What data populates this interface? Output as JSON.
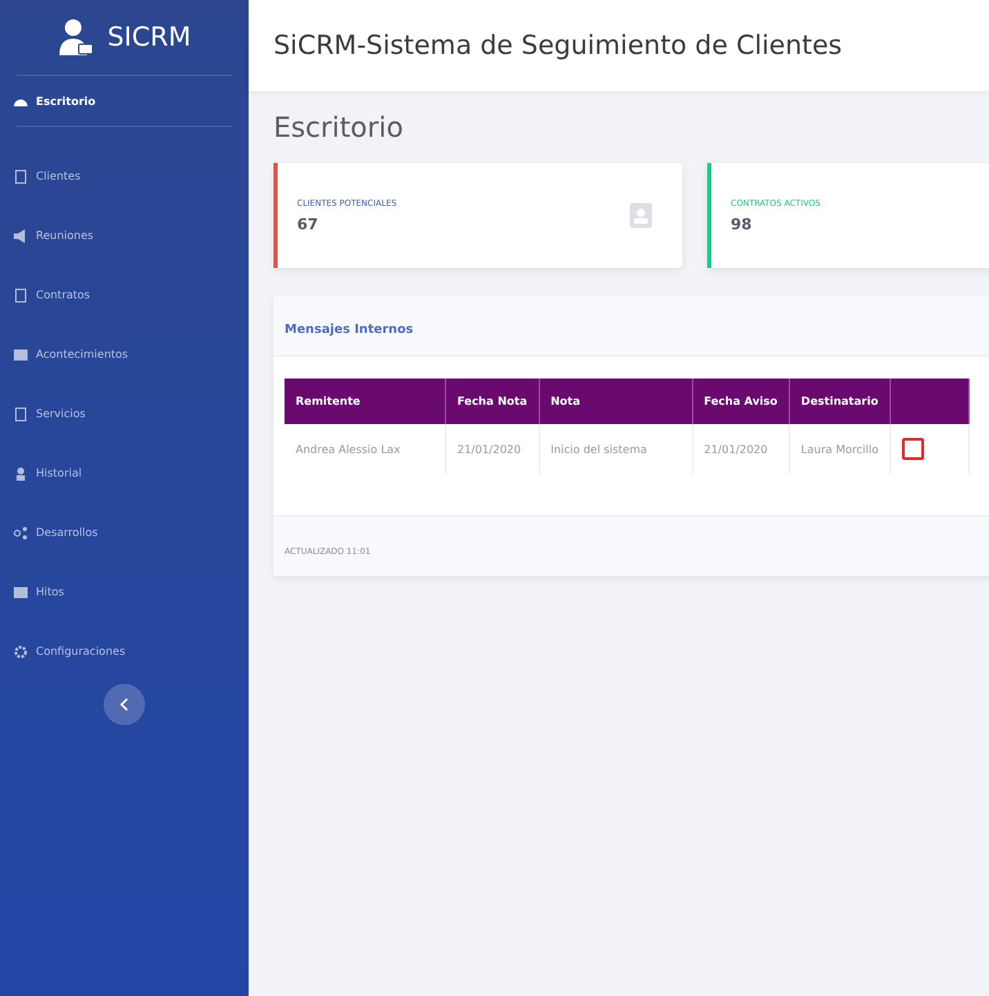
{
  "sidebar": {
    "brand": "SICRM",
    "items": [
      {
        "label": "Escritorio",
        "selected": true
      },
      {
        "label": "Clientes",
        "selected": false
      },
      {
        "label": "Reuniones",
        "selected": false
      },
      {
        "label": "Contratos",
        "selected": false
      },
      {
        "label": "Acontecimientos",
        "selected": false
      },
      {
        "label": "Servicios",
        "selected": false
      },
      {
        "label": "Historial",
        "selected": false
      },
      {
        "label": "Desarrollos",
        "selected": false
      },
      {
        "label": "Hitos",
        "selected": false
      },
      {
        "label": "Configuraciones",
        "selected": false
      }
    ]
  },
  "topbar": {
    "title": "SiCRM-Sistema de Seguimiento de Clientes"
  },
  "page_title": "Escritorio",
  "cards": [
    {
      "label": "CLIENTES POTENCIALES",
      "value": "67",
      "color": "#d9534f",
      "kind": "contact"
    },
    {
      "label": "CONTRATOS ACTIVOS",
      "value": "98",
      "color": "#1cc88a",
      "kind": "plain"
    }
  ],
  "messages": {
    "title": "Mensajes Internos",
    "columns": [
      "Remitente",
      "Fecha Nota",
      "Nota",
      "Fecha Aviso",
      "Destinatario"
    ],
    "rows": [
      {
        "cells": [
          "Andrea Alessio Lax",
          "21/01/2020",
          "Inicio del sistema",
          "21/01/2020",
          "Laura Morcillo"
        ]
      }
    ],
    "footer": "ACTUALIZADO 11:01"
  }
}
